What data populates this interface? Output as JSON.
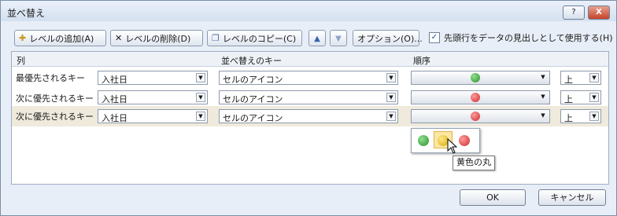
{
  "window": {
    "title": "並べ替え",
    "help_label": "?",
    "close_label": "X"
  },
  "toolbar": {
    "add_level": "レベルの追加(A)",
    "delete_level": "レベルの削除(D)",
    "copy_level": "レベルのコピー(C)",
    "options": "オプション(O)...",
    "header_checkbox_label": "先頭行をデータの見出しとして使用する(H)",
    "header_checkbox_checked": true
  },
  "grid": {
    "headers": {
      "column": "列",
      "sort_key": "並べ替えのキー",
      "order": "順序"
    },
    "rows": [
      {
        "label": "最優先されるキー",
        "column": "入社日",
        "sort_key": "セルのアイコン",
        "icon": "green-circle",
        "direction": "上"
      },
      {
        "label": "次に優先されるキー",
        "column": "入社日",
        "sort_key": "セルのアイコン",
        "icon": "red-circle",
        "direction": "上"
      },
      {
        "label": "次に優先されるキー",
        "column": "入社日",
        "sort_key": "セルのアイコン",
        "icon": "red-circle",
        "direction": "上"
      }
    ]
  },
  "icon_popup": {
    "options": [
      "green-circle",
      "yellow-circle",
      "red-circle"
    ],
    "hovered": "yellow-circle",
    "tooltip": "黄色の丸"
  },
  "footer": {
    "ok": "OK",
    "cancel": "キャンセル"
  },
  "colors": {
    "green": "#2e8f2e",
    "yellow": "#d9a800",
    "red": "#cc2b2b",
    "selected_row": "#efeadc"
  }
}
